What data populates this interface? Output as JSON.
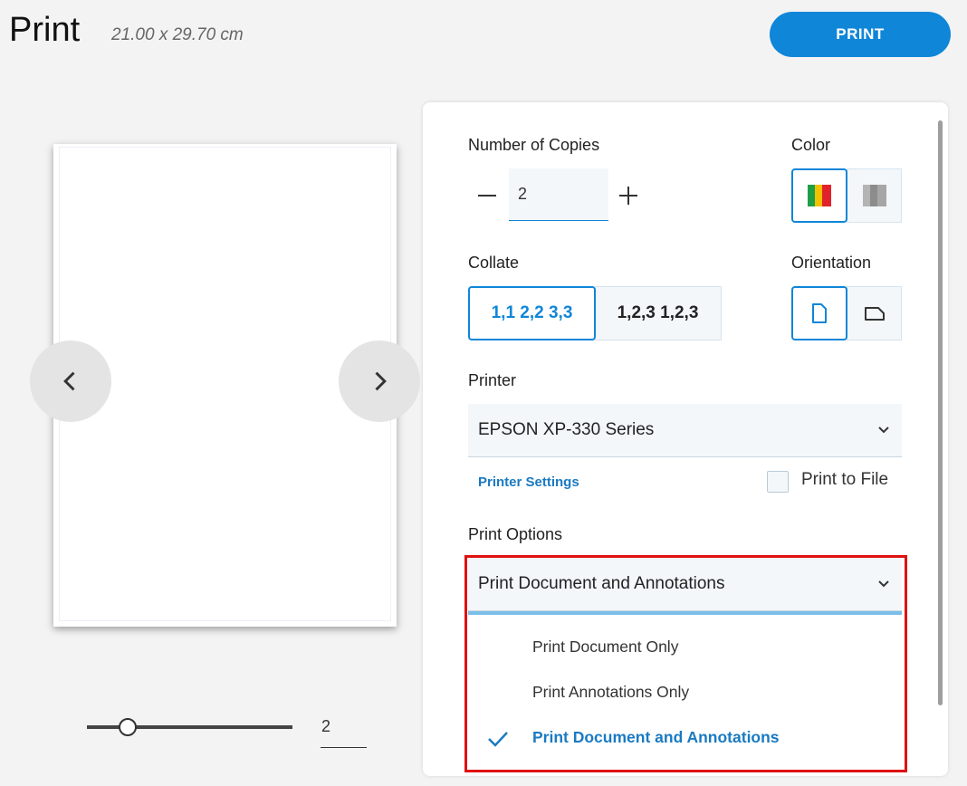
{
  "header": {
    "title": "Print",
    "dimensions": "21.00 x 29.70 cm",
    "print_button": "PRINT"
  },
  "preview": {
    "zoom_value": "2",
    "zoom_slider_fraction": 0.2
  },
  "copies": {
    "label": "Number of Copies",
    "value": "2"
  },
  "color": {
    "label": "Color",
    "options": [
      "color-icon",
      "grayscale-icon"
    ],
    "selected": "color-icon"
  },
  "collate": {
    "label": "Collate",
    "options": [
      "1,1 2,2 3,3",
      "1,2,3 1,2,3"
    ],
    "selected": 0
  },
  "orientation": {
    "label": "Orientation",
    "options": [
      "portrait-icon",
      "landscape-icon"
    ],
    "selected": "portrait-icon"
  },
  "printer": {
    "label": "Printer",
    "value": "EPSON XP-330 Series",
    "settings_link": "Printer Settings",
    "print_to_file": "Print to File"
  },
  "print_options": {
    "label": "Print Options",
    "value": "Print Document and Annotations",
    "items": [
      "Print Document Only",
      "Print Annotations Only",
      "Print Document and Annotations"
    ],
    "selected_index": 2
  },
  "colors": {
    "accent": "#0f86d8",
    "highlight": "#e01010"
  }
}
